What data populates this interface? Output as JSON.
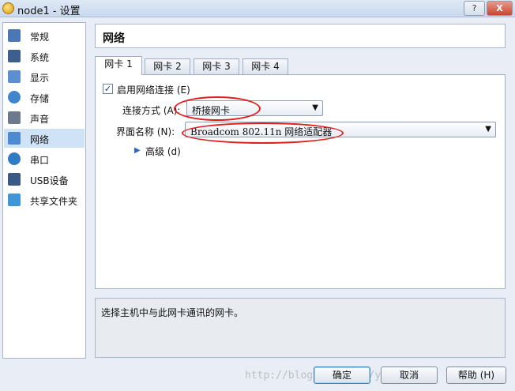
{
  "window": {
    "title": "node1 - 设置",
    "help_label": "?",
    "close_label": "X"
  },
  "sidebar": {
    "items": [
      {
        "label": "常规",
        "icon": "general-icon",
        "color": "#4a78b6"
      },
      {
        "label": "系统",
        "icon": "system-icon",
        "color": "#3d5f8c"
      },
      {
        "label": "显示",
        "icon": "display-icon",
        "color": "#5b8fd0"
      },
      {
        "label": "存储",
        "icon": "storage-icon",
        "color": "#3f86cc"
      },
      {
        "label": "声音",
        "icon": "audio-icon",
        "color": "#6c7a8c"
      },
      {
        "label": "网络",
        "icon": "network-icon",
        "color": "#4d8ad1"
      },
      {
        "label": "串口",
        "icon": "serial-port-icon",
        "color": "#2f7bc4"
      },
      {
        "label": "USB设备",
        "icon": "usb-icon",
        "color": "#3a5a84"
      },
      {
        "label": "共享文件夹",
        "icon": "shared-folder-icon",
        "color": "#3f95d6"
      }
    ],
    "selected": "网络"
  },
  "main": {
    "heading": "网络",
    "tabs": [
      {
        "label": "网卡 1"
      },
      {
        "label": "网卡 2"
      },
      {
        "label": "网卡 3"
      },
      {
        "label": "网卡 4"
      }
    ],
    "enable_label": "启用网络连接 (E)",
    "enable_checked": "✓",
    "attach_label": "连接方式 (A):",
    "attach_value": "桥接网卡",
    "interface_label": "界面名称 (N):",
    "interface_value": "Broadcom 802.11n 网络适配器",
    "advanced_label": "高级 (d)",
    "description": "选择主机中与此网卡通讯的网卡。"
  },
  "buttons": {
    "ok": "确定",
    "cancel": "取消",
    "help": "帮助 (H)"
  },
  "watermark": "http://blog.csdn.net/yang_ting",
  "colors": {
    "annotation": "#e21d1d",
    "selection": "#cfe2f6"
  }
}
